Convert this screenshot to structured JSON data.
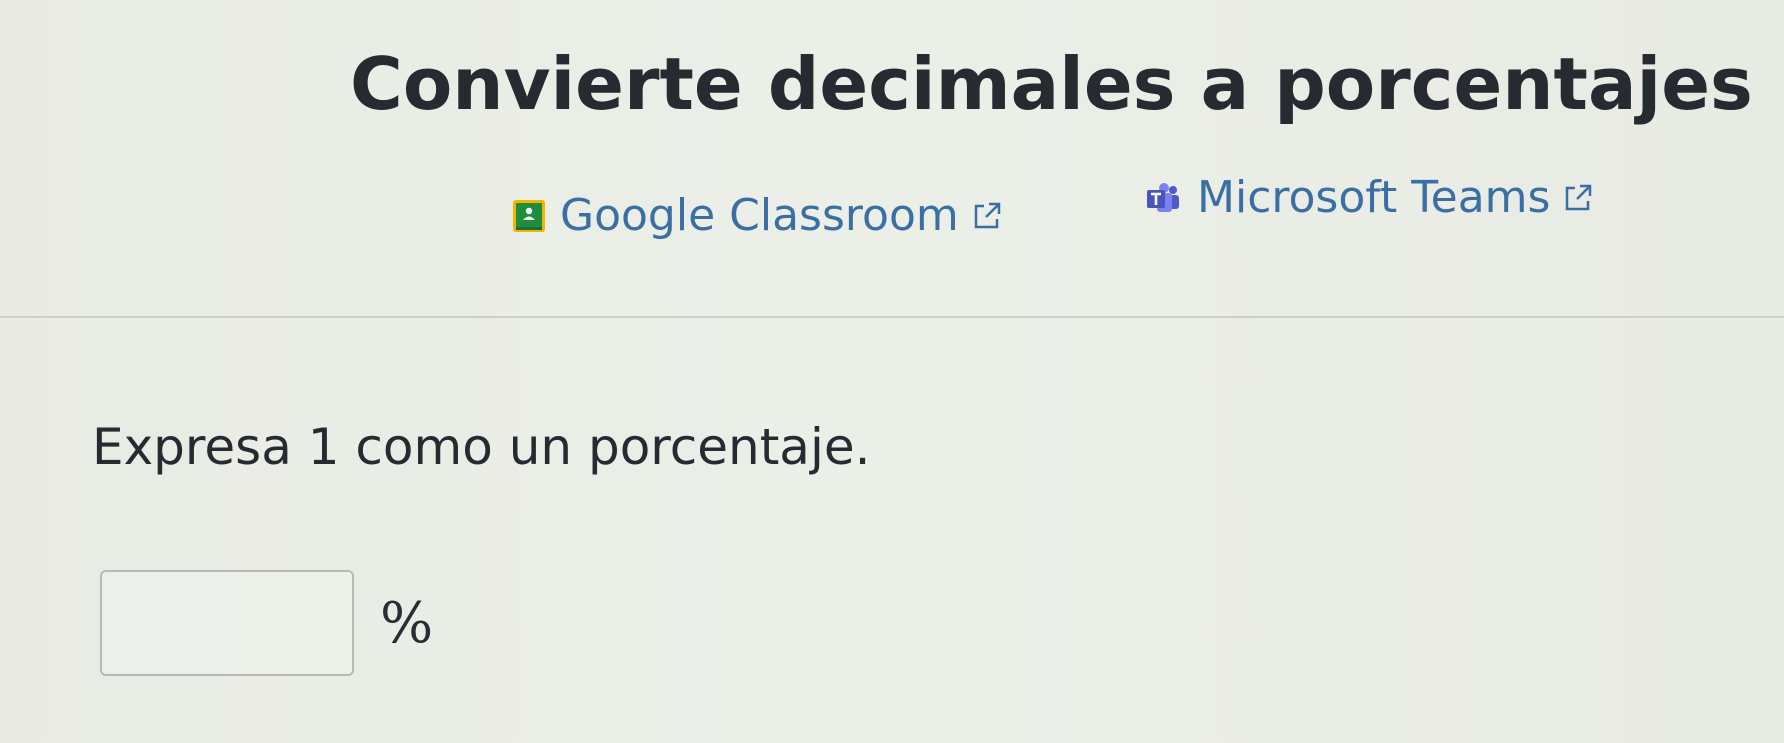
{
  "exercise": {
    "title": "Convierte decimales a porcentajes"
  },
  "share": {
    "classroom": {
      "label": "Google Classroom",
      "icon": "google-classroom-icon",
      "external_icon": "external-link-icon",
      "color": "#3a6fa6"
    },
    "teams": {
      "label": "Microsoft Teams",
      "icon": "microsoft-teams-icon",
      "external_icon": "external-link-icon",
      "color": "#3a6fa6"
    }
  },
  "question": {
    "prompt": "Expresa 1 como un porcentaje.",
    "answer_value": "",
    "unit": "%"
  }
}
